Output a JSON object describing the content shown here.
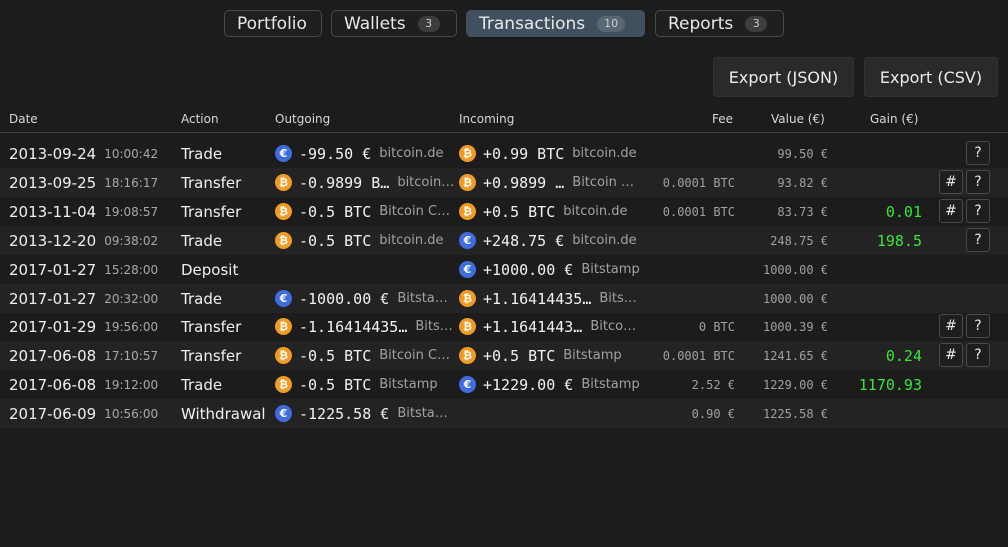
{
  "tabs": [
    {
      "label": "Portfolio",
      "badge": ""
    },
    {
      "label": "Wallets",
      "badge": "3"
    },
    {
      "label": "Transactions",
      "badge": "10"
    },
    {
      "label": "Reports",
      "badge": "3"
    }
  ],
  "active_tab": "Transactions",
  "exports": {
    "json_label": "Export (JSON)",
    "csv_label": "Export (CSV)"
  },
  "columns": {
    "date": "Date",
    "action": "Action",
    "outgoing": "Outgoing",
    "incoming": "Incoming",
    "fee": "Fee",
    "value": "Value (€)",
    "gain": "Gain (€)"
  },
  "colors": {
    "background": "#1c1c1c",
    "active_tab": "#41505f",
    "eur_icon": "#3e6de0",
    "btc_icon": "#f39a24",
    "gain": "#39e639"
  },
  "transactions": [
    {
      "date": "2013-09-24",
      "time": "10:00:42",
      "action": "Trade",
      "out_icon": "eur",
      "out_amount": "-99.50 €",
      "out_wallet": "bitcoin.de",
      "in_icon": "btc",
      "in_amount": "+0.99 BTC",
      "in_wallet": "bitcoin.de",
      "fee": "",
      "value": "99.50 €",
      "gain": "",
      "hash_btn": "",
      "help_btn": "?"
    },
    {
      "date": "2013-09-25",
      "time": "18:16:17",
      "action": "Transfer",
      "out_icon": "btc",
      "out_amount": "-0.9899 B…",
      "out_wallet": "bitcoin…",
      "in_icon": "btc",
      "in_amount": "+0.9899 …",
      "in_wallet": "Bitcoin …",
      "fee": "0.0001 BTC",
      "value": "93.82 €",
      "gain": "",
      "hash_btn": "#",
      "help_btn": "?"
    },
    {
      "date": "2013-11-04",
      "time": "19:08:57",
      "action": "Transfer",
      "out_icon": "btc",
      "out_amount": "-0.5 BTC",
      "out_wallet": "Bitcoin Core",
      "in_icon": "btc",
      "in_amount": "+0.5 BTC",
      "in_wallet": "bitcoin.de",
      "fee": "0.0001 BTC",
      "value": "83.73 €",
      "gain": "0.01",
      "hash_btn": "#",
      "help_btn": "?"
    },
    {
      "date": "2013-12-20",
      "time": "09:38:02",
      "action": "Trade",
      "out_icon": "btc",
      "out_amount": "-0.5 BTC",
      "out_wallet": "bitcoin.de",
      "in_icon": "eur",
      "in_amount": "+248.75 €",
      "in_wallet": "bitcoin.de",
      "fee": "",
      "value": "248.75 €",
      "gain": "198.5",
      "hash_btn": "",
      "help_btn": "?"
    },
    {
      "date": "2017-01-27",
      "time": "15:28:00",
      "action": "Deposit",
      "out_icon": "",
      "out_amount": "",
      "out_wallet": "",
      "in_icon": "eur",
      "in_amount": "+1000.00 €",
      "in_wallet": "Bitstamp",
      "fee": "",
      "value": "1000.00 €",
      "gain": "",
      "hash_btn": "",
      "help_btn": ""
    },
    {
      "date": "2017-01-27",
      "time": "20:32:00",
      "action": "Trade",
      "out_icon": "eur",
      "out_amount": "-1000.00 €",
      "out_wallet": "Bitstamp",
      "in_icon": "btc",
      "in_amount": "+1.16414435…",
      "in_wallet": "Bits…",
      "fee": "",
      "value": "1000.00 €",
      "gain": "",
      "hash_btn": "",
      "help_btn": ""
    },
    {
      "date": "2017-01-29",
      "time": "19:56:00",
      "action": "Transfer",
      "out_icon": "btc",
      "out_amount": "-1.16414435…",
      "out_wallet": "Bits…",
      "in_icon": "btc",
      "in_amount": "+1.1641443…",
      "in_wallet": "Bitco…",
      "fee": "0 BTC",
      "value": "1000.39 €",
      "gain": "",
      "hash_btn": "#",
      "help_btn": "?"
    },
    {
      "date": "2017-06-08",
      "time": "17:10:57",
      "action": "Transfer",
      "out_icon": "btc",
      "out_amount": "-0.5 BTC",
      "out_wallet": "Bitcoin Core",
      "in_icon": "btc",
      "in_amount": "+0.5 BTC",
      "in_wallet": "Bitstamp",
      "fee": "0.0001 BTC",
      "value": "1241.65 €",
      "gain": "0.24",
      "hash_btn": "#",
      "help_btn": "?"
    },
    {
      "date": "2017-06-08",
      "time": "19:12:00",
      "action": "Trade",
      "out_icon": "btc",
      "out_amount": "-0.5 BTC",
      "out_wallet": "Bitstamp",
      "in_icon": "eur",
      "in_amount": "+1229.00 €",
      "in_wallet": "Bitstamp",
      "fee": "2.52 €",
      "value": "1229.00 €",
      "gain": "1170.93",
      "hash_btn": "",
      "help_btn": ""
    },
    {
      "date": "2017-06-09",
      "time": "10:56:00",
      "action": "Withdrawal",
      "out_icon": "eur",
      "out_amount": "-1225.58 €",
      "out_wallet": "Bitstamp",
      "in_icon": "",
      "in_amount": "",
      "in_wallet": "",
      "fee": "0.90 €",
      "value": "1225.58 €",
      "gain": "",
      "hash_btn": "",
      "help_btn": ""
    }
  ]
}
